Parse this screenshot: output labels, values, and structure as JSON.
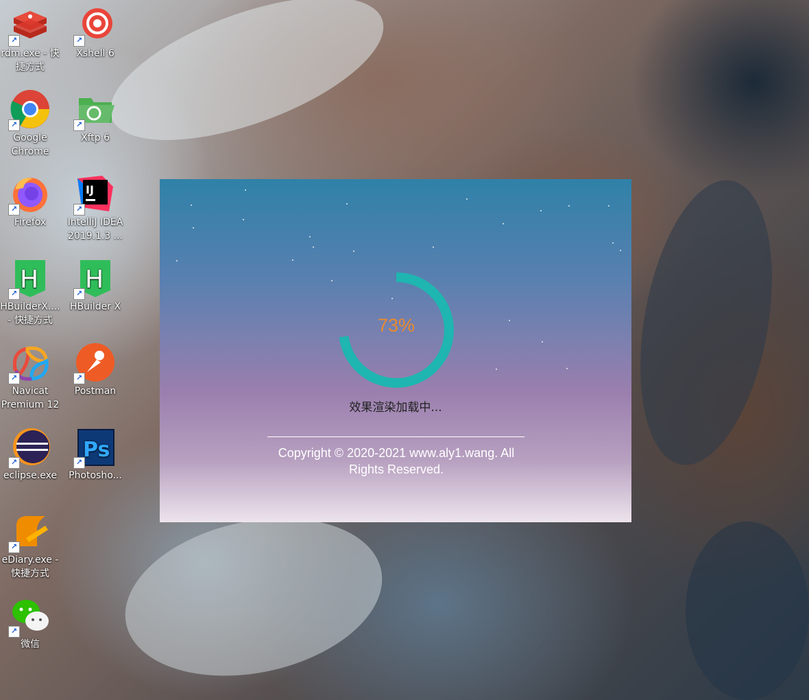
{
  "desktop": {
    "icons": [
      {
        "label": "rdm.exe - 快\n捷方式"
      },
      {
        "label": "Xshell 6"
      },
      {
        "label": "Google\nChrome"
      },
      {
        "label": "Xftp 6"
      },
      {
        "label": "Firefox"
      },
      {
        "label": "IntelliJ IDEA\n2019.1.3 ..."
      },
      {
        "label": "HBuilderX....\n- 快捷方式"
      },
      {
        "label": "HBuilder X"
      },
      {
        "label": "Navicat\nPremium 12"
      },
      {
        "label": "Postman"
      },
      {
        "label": "eclipse.exe"
      },
      {
        "label": "Photosho..."
      },
      {
        "label": "eDiary.exe -\n快捷方式"
      },
      {
        "label": "微信"
      }
    ],
    "shortcut_arrow": "↗"
  },
  "loader": {
    "progress_fraction": 0.73,
    "percent_text": "73%",
    "status_text": "效果渲染加载中...",
    "copyright": "Copyright © 2020-2021 www.aly1.wang. All Rights Reserved.",
    "colors": {
      "ring": "#1fb5b0",
      "percent": "#e98a2e"
    }
  },
  "icon_glyphs": {
    "ij": "IJ",
    "hbuilder": "H",
    "ps": "Ps"
  }
}
